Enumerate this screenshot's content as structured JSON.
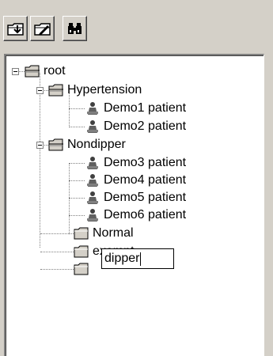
{
  "toolbar": {
    "buttons": [
      {
        "icon": "new-folder-icon"
      },
      {
        "icon": "edit-folder-icon"
      },
      {
        "icon": "find-binoculars-icon"
      }
    ]
  },
  "tree": {
    "root_label": "root",
    "groups": [
      {
        "label": "Hypertension",
        "expanded": true,
        "patients": [
          "Demo1 patient",
          "Demo2 patient"
        ]
      },
      {
        "label": "Nondipper",
        "expanded": true,
        "patients": [
          "Demo3 patient",
          "Demo4 patient",
          "Demo5 patient",
          "Demo6 patient"
        ]
      },
      {
        "label": "Normal",
        "expanded": false,
        "patients": []
      },
      {
        "label": "exempt",
        "expanded": false,
        "patients": []
      }
    ],
    "editing_node": {
      "value": "dipper"
    }
  }
}
